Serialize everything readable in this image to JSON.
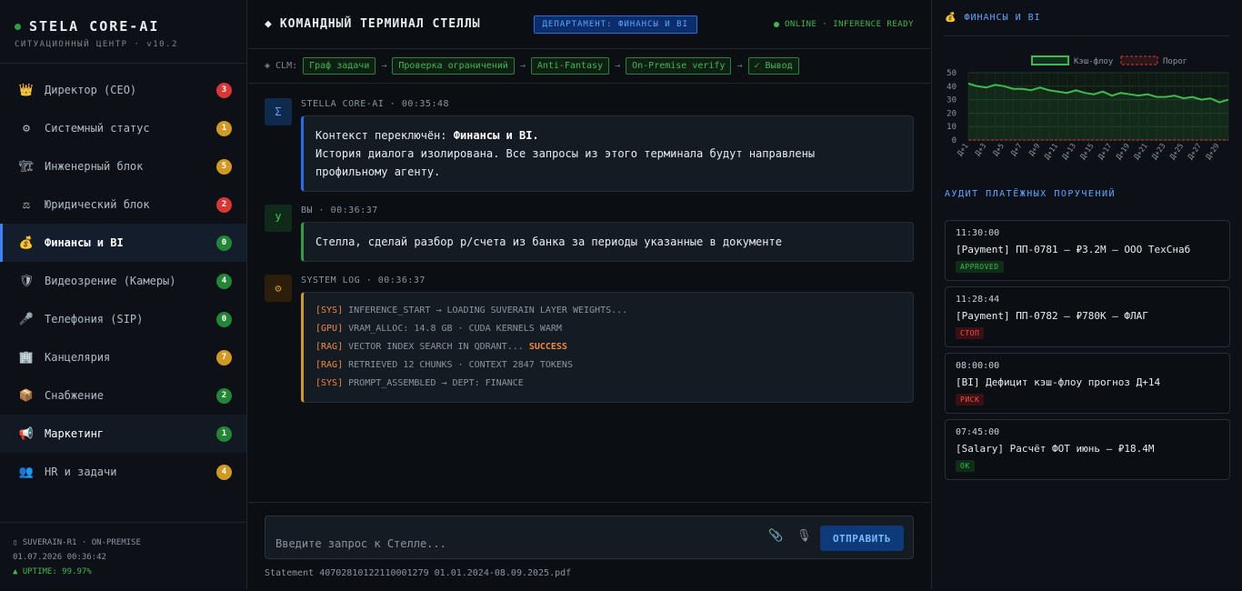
{
  "brand": {
    "title": "STELA CORE-AI",
    "subtitle": "СИТУАЦИОННЫЙ ЦЕНТР · v10.2"
  },
  "sidebar": {
    "items": [
      {
        "icon": "👑",
        "icon_name": "crown-icon",
        "label": "Директор (CEO)",
        "badge": "3",
        "badge_color": "red"
      },
      {
        "icon": "⚙",
        "icon_name": "gear-icon",
        "label": "Системный статус",
        "badge": "1",
        "badge_color": "orange"
      },
      {
        "icon": "🏗",
        "icon_name": "construction-icon",
        "label": "Инженерный блок",
        "badge": "5",
        "badge_color": "orange"
      },
      {
        "icon": "⚖",
        "icon_name": "scales-icon",
        "label": "Юридический блок",
        "badge": "2",
        "badge_color": "red"
      },
      {
        "icon": "💰",
        "icon_name": "money-bag-icon",
        "label": "Финансы и BI",
        "badge": "0",
        "badge_color": "green"
      },
      {
        "icon": "🛡",
        "icon_name": "shield-icon",
        "label": "Видеозрение (Камеры)",
        "badge": "4",
        "badge_color": "green"
      },
      {
        "icon": "🎤",
        "icon_name": "microphone-icon",
        "label": "Телефония (SIP)",
        "badge": "0",
        "badge_color": "green"
      },
      {
        "icon": "🏢",
        "icon_name": "office-building-icon",
        "label": "Канцелярия",
        "badge": "7",
        "badge_color": "orange"
      },
      {
        "icon": "📦",
        "icon_name": "package-icon",
        "label": "Снабжение",
        "badge": "2",
        "badge_color": "green"
      },
      {
        "icon": "📢",
        "icon_name": "megaphone-icon",
        "label": "Маркетинг",
        "badge": "1",
        "badge_color": "green"
      },
      {
        "icon": "👥",
        "icon_name": "people-icon",
        "label": "HR и задачи",
        "badge": "4",
        "badge_color": "orange"
      }
    ],
    "footer": {
      "line1": "▯ SUVERAIN-R1 · ON-PREMISE",
      "line2": "01.07.2026 00:36:42",
      "line3": "▲ UPTIME: 99.97%"
    }
  },
  "terminal": {
    "title": "КОМАНДНЫЙ ТЕРМИНАЛ СТЕЛЛЫ",
    "title_icon": "◆",
    "dept_chip": "ДЕПАРТАМЕНТ: ФИНАНСЫ И BI",
    "status": "ONLINE · INFERENCE READY",
    "clm_label": "◈ CLM:",
    "clm_steps": [
      "Граф задачи",
      "Проверка ограничений",
      "Anti-Fantasy",
      "On-Premise verify",
      "✓ Вывод"
    ],
    "messages": {
      "ai": {
        "avatar": "Σ",
        "meta": "STELLA CORE-AI · 00:35:48",
        "line1_prefix": "Контекст переключён: ",
        "line1_bold": "Финансы и BI.",
        "line2": "История диалога изолирована. Все запросы из этого терминала будут направлены",
        "line3": "профильному агенту."
      },
      "user": {
        "avatar": "У",
        "meta": "ВЫ · 00:36:37",
        "text": "Стелла, сделай разбор р/счета из банка за периоды указанные в документе"
      },
      "sys": {
        "avatar": "⚙",
        "meta": "SYSTEM LOG · 00:36:37",
        "lines": [
          {
            "tag": "[SYS]",
            "text": " INFERENCE_START → LOADING SUVERAIN LAYER WEIGHTS...",
            "suffix": ""
          },
          {
            "tag": "[GPU]",
            "text": " VRAM_ALLOC: 14.8 GB · CUDA KERNELS WARM",
            "suffix": ""
          },
          {
            "tag": "[RAG]",
            "text": " VECTOR INDEX SEARCH IN QDRANT... ",
            "suffix": "SUCCESS"
          },
          {
            "tag": "[RAG]",
            "text": " RETRIEVED 12 CHUNKS · CONTEXT 2847 TOKENS",
            "suffix": ""
          },
          {
            "tag": "[SYS]",
            "text": " PROMPT_ASSEMBLED → DEPT: FINANCE",
            "suffix": ""
          }
        ]
      }
    },
    "composer": {
      "placeholder": "Введите запрос к Стелле...",
      "value": "",
      "send_label": "ОТПРАВИТЬ",
      "attach_icon": "paperclip-icon",
      "mic_icon": "microphone-icon",
      "attachment": "Statement 40702810122110001279 01.01.2024-08.09.2025.pdf"
    }
  },
  "finance": {
    "header": "ФИНАНСЫ И BI",
    "header_icon": "💰",
    "audit_header": "АУДИТ ПЛАТЁЖНЫХ ПОРУЧЕНИЙ",
    "audit": [
      {
        "time": "11:30:00",
        "title": "[Payment] ПП-0781 — ₽3.2М — ООО ТехСнаб",
        "tag": "APPROVED",
        "tag_color": "green"
      },
      {
        "time": "11:28:44",
        "title": "[Payment] ПП-0782 — ₽780К — ФЛАГ",
        "tag": "СТОП",
        "tag_color": "red"
      },
      {
        "time": "08:00:00",
        "title": "[BI] Дефицит кэш-флоу прогноз Д+14",
        "tag": "РИСК",
        "tag_color": "red"
      },
      {
        "time": "07:45:00",
        "title": "[Salary] Расчёт ФОТ июнь — ₽18.4М",
        "tag": "OK",
        "tag_color": "green"
      }
    ]
  },
  "chart_data": {
    "type": "line",
    "categories": [
      "Д+1",
      "Д+2",
      "Д+3",
      "Д+4",
      "Д+5",
      "Д+6",
      "Д+7",
      "Д+8",
      "Д+9",
      "Д+10",
      "Д+11",
      "Д+12",
      "Д+13",
      "Д+14",
      "Д+15",
      "Д+16",
      "Д+17",
      "Д+18",
      "Д+19",
      "Д+20",
      "Д+21",
      "Д+22",
      "Д+23",
      "Д+24",
      "Д+25",
      "Д+26",
      "Д+27",
      "Д+28",
      "Д+29",
      "Д+30"
    ],
    "tick_labels": [
      "Д+1",
      "Д+3",
      "Д+5",
      "Д+7",
      "Д+9",
      "Д+11",
      "Д+13",
      "Д+15",
      "Д+17",
      "Д+19",
      "Д+21",
      "Д+23",
      "Д+25",
      "Д+27",
      "Д+29"
    ],
    "series": [
      {
        "name": "Кэш-флоу",
        "color": "#3fb950",
        "style": "solid",
        "values": [
          42,
          40,
          39,
          41,
          40,
          38,
          38,
          37,
          39,
          37,
          36,
          35,
          37,
          35,
          34,
          36,
          33,
          35,
          34,
          33,
          34,
          32,
          32,
          33,
          31,
          32,
          30,
          31,
          28,
          30
        ]
      },
      {
        "name": "Порог",
        "color": "#da3633",
        "style": "dashed",
        "values": [
          0,
          0,
          0,
          0,
          0,
          0,
          0,
          0,
          0,
          0,
          0,
          0,
          0,
          0,
          0,
          0,
          0,
          0,
          0,
          0,
          0,
          0,
          0,
          0,
          0,
          0,
          0,
          0,
          0,
          0
        ]
      }
    ],
    "yticks": [
      0,
      10,
      20,
      30,
      40,
      50
    ],
    "ylim": [
      0,
      50
    ],
    "grid": true,
    "legend": "top-center",
    "title": "",
    "xlabel": "",
    "ylabel": ""
  }
}
